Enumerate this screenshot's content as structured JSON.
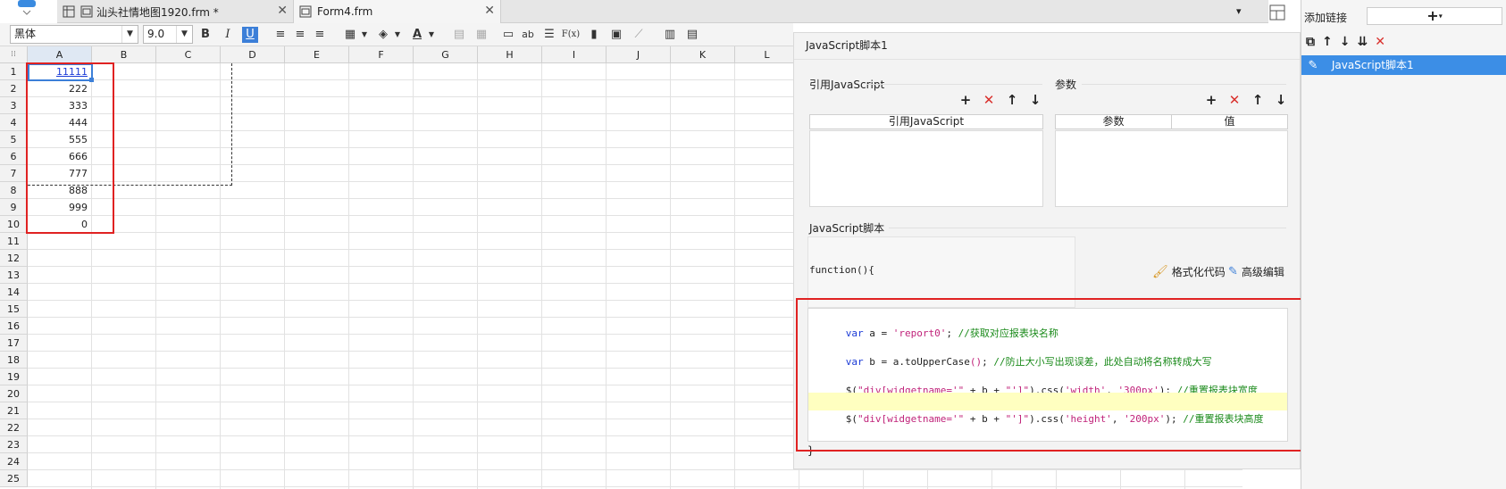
{
  "tabs": [
    {
      "label": "汕头社情地图1920.frm *",
      "close": "✕"
    },
    {
      "label": "Form4.frm",
      "close": "✕"
    }
  ],
  "toolbar": {
    "font": "黑体",
    "size": "9.0",
    "bold": "B",
    "italic": "I",
    "underline": "U",
    "fx": "F(x)",
    "ab": "ab"
  },
  "sheet": {
    "columns": [
      "A",
      "B",
      "C",
      "D",
      "E",
      "F",
      "G",
      "H",
      "I",
      "J",
      "K",
      "L"
    ],
    "rows": [
      "1",
      "2",
      "3",
      "4",
      "5",
      "6",
      "7",
      "8",
      "9",
      "10",
      "11",
      "12",
      "13",
      "14",
      "15",
      "16",
      "17",
      "18",
      "19",
      "20",
      "21",
      "22",
      "23",
      "24",
      "25"
    ],
    "values": [
      "11111",
      "222",
      "333",
      "444",
      "555",
      "666",
      "777",
      "888",
      "999",
      "0"
    ]
  },
  "dialog": {
    "title": "JavaScript脚本1",
    "ref_section": "引用JavaScript",
    "ref_header": "引用JavaScript",
    "param_section": "参数",
    "param_col1": "参数",
    "param_col2": "值",
    "script_section": "JavaScript脚本",
    "function_label": "function(){",
    "format_code": "格式化代码",
    "advanced_edit": "高级编辑",
    "closing_brace": "}",
    "code": {
      "l1": {
        "kw": "var",
        "a": " a = ",
        "s": "'report0'",
        "b": "; ",
        "c": "//获取对应报表块名称"
      },
      "l2": {
        "kw": "var",
        "a": " b = a.toUpperCase",
        "p": "()",
        "b": "; ",
        "c": "//防止大小写出现误差，此处自动将名称转成大写"
      },
      "l3": {
        "a": "$(",
        "s1": "\"div[widgetname='\"",
        "m": " + b + ",
        "s2": "\"']\"",
        "b": ").css(",
        "s3": "'width'",
        "c1": ", ",
        "s4": "'300px'",
        "e": "); ",
        "c": "//重置报表块宽度"
      },
      "l4": {
        "a": "$(",
        "s1": "\"div[widgetname='\"",
        "m": " + b + ",
        "s2": "\"']\"",
        "b": ").css(",
        "s3": "'height'",
        "c1": ", ",
        "s4": "'200px'",
        "e": "); ",
        "c": "//重置报表块高度"
      }
    }
  },
  "right_panel": {
    "add_link": "添加链接",
    "plus": "+",
    "selected": "JavaScript脚本1"
  },
  "colors": {
    "highlight": "#ffffc0",
    "selection": "#3c8ee6",
    "annotation": "#e02222"
  }
}
